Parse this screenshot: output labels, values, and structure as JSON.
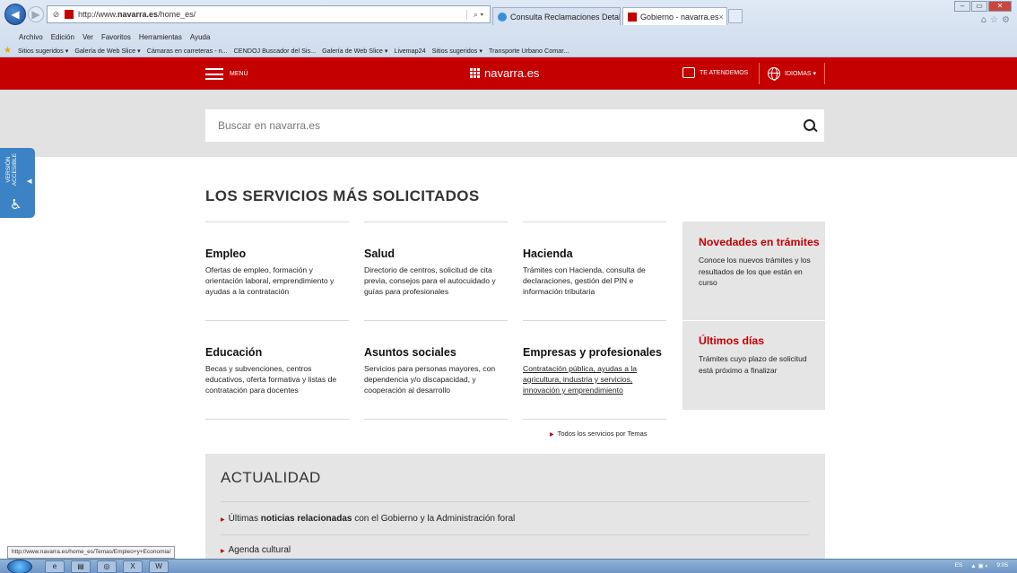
{
  "browser": {
    "url_prefix": "http://www.",
    "url_domain": "navarra.es",
    "url_path": "/home_es/",
    "tabs": [
      {
        "title": "Consulta Reclamaciones Detalle"
      },
      {
        "title": "Gobierno - navarra.es",
        "close": "×"
      }
    ],
    "menu": [
      "Archivo",
      "Edición",
      "Ver",
      "Favoritos",
      "Herramientas",
      "Ayuda"
    ],
    "favorites": [
      "Sitios sugeridos ▾",
      "Galería de Web Slice ▾",
      "Cámaras en carreteras - n...",
      "CENDOJ Buscador del Sis...",
      "Galería de Web Slice ▾",
      "Livemap24",
      "Sitios sugeridos ▾",
      "Transporte Urbano Comar..."
    ],
    "status_url": "http://www.navarra.es/home_es/Temas/Empleo+y+Economia/"
  },
  "header": {
    "menu_label": "MENÚ",
    "logo": "navarra.es",
    "atendemos": "TE ATENDEMOS",
    "idiomas": "IDIOMAS ▾",
    "brand_color": "#c40000"
  },
  "search": {
    "placeholder": "Buscar en navarra.es"
  },
  "accessibility": {
    "line1": "VERSIÓN",
    "line2": "ACCESIBLE"
  },
  "services": {
    "title": "LOS SERVICIOS MÁS SOLICITADOS",
    "cards": [
      {
        "title": "Empleo",
        "text": "Ofertas de empleo, formación y orientación laboral, emprendimiento y ayudas a la contratación"
      },
      {
        "title": "Salud",
        "text": "Directorio de centros, solicitud de cita previa, consejos para el autocuidado y guías para profesionales"
      },
      {
        "title": "Hacienda",
        "text": "Trámites con Hacienda, consulta de declaraciones, gestión del PIN e información tributaria"
      },
      {
        "title": "Educación",
        "text": "Becas y subvenciones, centros educativos, oferta formativa y listas de contratación para docentes"
      },
      {
        "title": "Asuntos sociales",
        "text": "Servicios para personas mayores, con dependencia y/o discapacidad, y cooperación al desarrollo"
      },
      {
        "title": "Empresas y profesionales",
        "text": "Contratación pública, ayudas a la agricultura, industria y servicios, innovación y emprendimiento"
      }
    ],
    "all_link": "Todos los servicios por Temas"
  },
  "sidebar": {
    "novedades": {
      "title": "Novedades en trámites",
      "text": "Conoce los nuevos trámites y los resultados de los que están en curso"
    },
    "ultimos": {
      "title": "Últimos días",
      "text": "Trámites cuyo plazo de solicitud está próximo a finalizar"
    }
  },
  "actualidad": {
    "title": "ACTUALIDAD",
    "item1_pre": "Últimas ",
    "item1_bold": "noticias relacionadas",
    "item1_post": " con el Gobierno y la Administración foral",
    "item2": "Agenda cultural"
  },
  "taskbar": {
    "lang": "ES",
    "time": "9:05"
  }
}
